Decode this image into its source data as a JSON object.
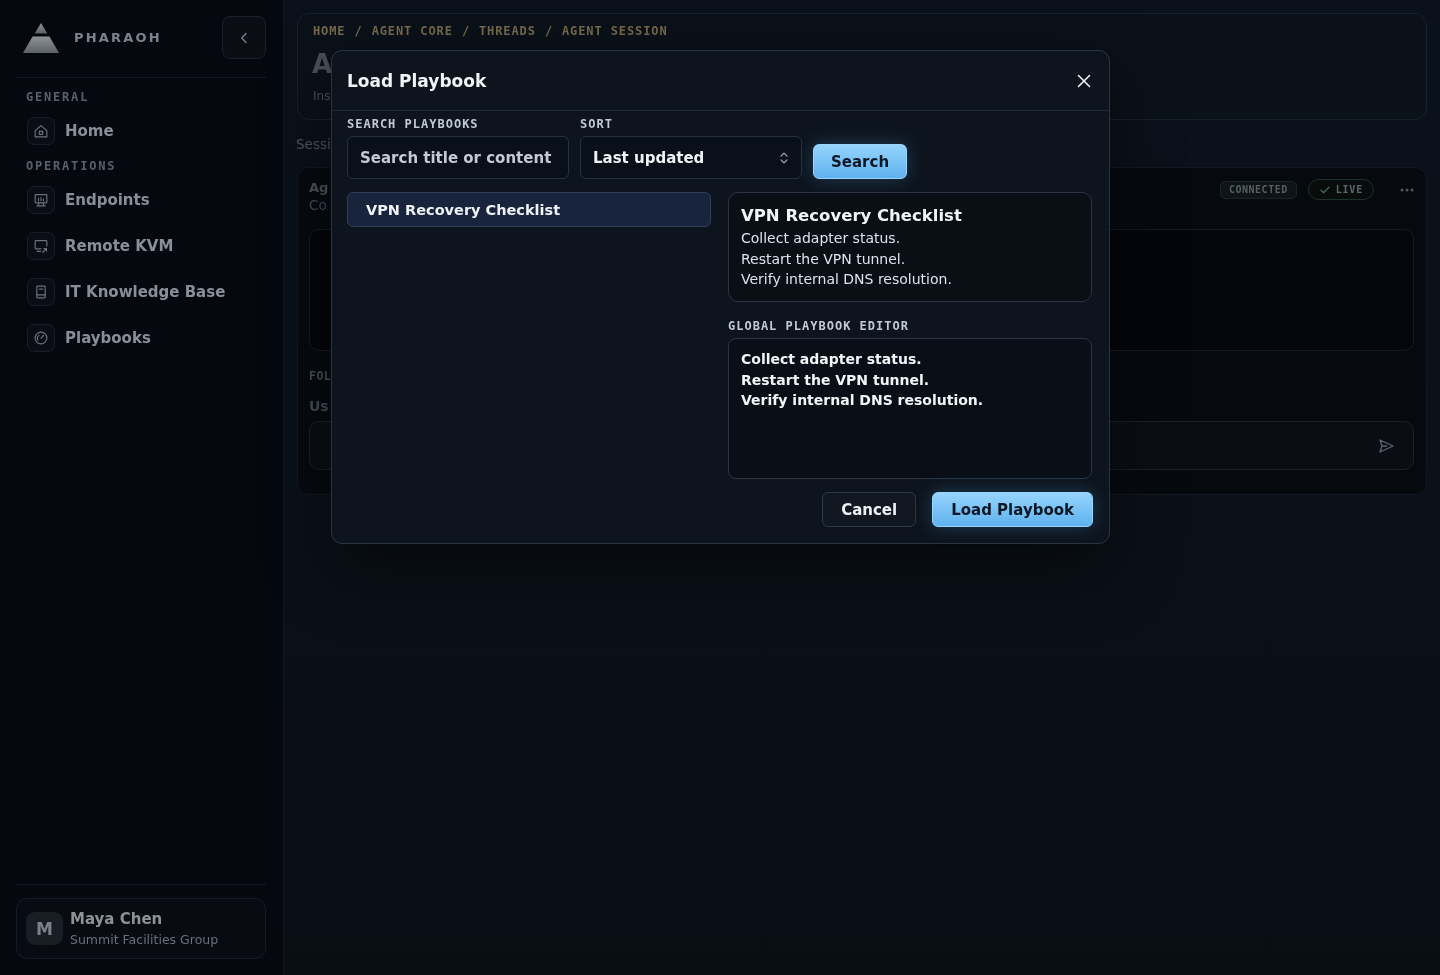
{
  "sidebar": {
    "brand": "PHARAOH",
    "sections": [
      {
        "title": "GENERAL",
        "items": [
          {
            "label": "Home"
          }
        ]
      },
      {
        "title": "OPERATIONS",
        "items": [
          {
            "label": "Endpoints"
          },
          {
            "label": "Remote KVM"
          },
          {
            "label": "IT Knowledge Base"
          },
          {
            "label": "Playbooks"
          }
        ]
      }
    ],
    "user": {
      "initial": "M",
      "name": "Maya Chen",
      "organization": "Summit Facilities Group"
    }
  },
  "header": {
    "breadcrumb": {
      "separator": "/",
      "items": [
        "HOME",
        "AGENT CORE",
        "THREADS",
        "AGENT SESSION"
      ]
    },
    "title": "A",
    "subtitle": "Ins"
  },
  "session_label": "Sessi",
  "thread": {
    "title": "Ag",
    "subtitle": "Co",
    "badges": [
      {
        "kind": "plain",
        "label": "CONNECTED"
      },
      {
        "kind": "check",
        "label": "LIVE"
      }
    ],
    "composer": {
      "label": "FOL",
      "hint": "Us"
    }
  },
  "modal": {
    "title": "Load Playbook",
    "search": {
      "label": "SEARCH PLAYBOOKS",
      "placeholder": "Search title or content"
    },
    "sort": {
      "label": "SORT",
      "value": "Last updated"
    },
    "search_button": "Search",
    "playbooks": [
      {
        "title": "VPN Recovery Checklist",
        "selected": true
      }
    ],
    "preview": {
      "title": "VPN Recovery Checklist",
      "lines": [
        "Collect adapter status.",
        "Restart the VPN tunnel.",
        "Verify internal DNS resolution."
      ]
    },
    "editor": {
      "label": "GLOBAL PLAYBOOK EDITOR",
      "value": "Collect adapter status.\nRestart the VPN tunnel.\nVerify internal DNS resolution."
    },
    "buttons": [
      {
        "kind": "secondary",
        "label": "Cancel"
      },
      {
        "kind": "primary",
        "label": "Load Playbook"
      }
    ]
  }
}
